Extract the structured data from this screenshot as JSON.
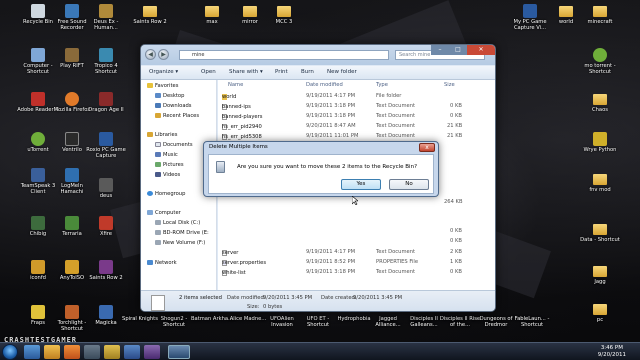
{
  "desktop_icons_left": [
    {
      "label": "Recycle Bin",
      "color": "#cfd8e0"
    },
    {
      "label": "Computer - Shortcut",
      "color": "#7fa7d6"
    },
    {
      "label": "Adobe Reader X",
      "color": "#c0302a"
    },
    {
      "label": "uTorrent",
      "color": "#6fae3a"
    },
    {
      "label": "TeamSpeak 3 Client",
      "color": "#3a5f9a"
    },
    {
      "label": "Chibig",
      "color": "#3d6b3d"
    },
    {
      "label": "iconfd",
      "color": "#d09a2a"
    },
    {
      "label": "Fraps",
      "color": "#e0c23a"
    }
  ],
  "desktop_icons_col2": [
    {
      "label": "Free Sound Recorder",
      "color": "#3a78b8"
    },
    {
      "label": "Play RIFT",
      "color": "#8a6a3a"
    },
    {
      "label": "Mozilla Firefox",
      "color": "#e07a2a"
    },
    {
      "label": "Ventrilo",
      "color": "#2a2a2a"
    },
    {
      "label": "LogMeIn Hamachi",
      "color": "#2f6fb0"
    },
    {
      "label": "Terraria",
      "color": "#4a8a3a"
    },
    {
      "label": "AnyToISO",
      "color": "#d4a02a"
    },
    {
      "label": "Torchlight - Shortcut",
      "color": "#c0602a"
    }
  ],
  "desktop_icons_col3": [
    {
      "label": "Deus Ex - Human...",
      "color": "#b08a3a"
    },
    {
      "label": "Tropico 4 Shortcut",
      "color": "#3a8ab0"
    },
    {
      "label": "Dragon Age II",
      "color": "#8a2a2a"
    },
    {
      "label": "Roxio PC Game Capture",
      "color": "#2a5aa0"
    },
    {
      "label": "deus",
      "color": "#5a5a5a"
    },
    {
      "label": "Xfire",
      "color": "#c03a2a"
    },
    {
      "label": "Saints Row 2",
      "color": "#7a3a8a"
    },
    {
      "label": "Magicka",
      "color": "#3a6ab0"
    }
  ],
  "desktop_icons_top": [
    {
      "label": "Saints Row 2"
    },
    {
      "label": "max"
    },
    {
      "label": "mirror"
    },
    {
      "label": "MCC 3"
    }
  ],
  "desktop_icons_bottom": [
    {
      "label": "Spiral Knights",
      "color": "#3a7ab0"
    },
    {
      "label": "Shogun2 - Shortcut",
      "color": "#8a2a2a"
    },
    {
      "label": "Batman Arkha...",
      "color": "#2a2a2a"
    },
    {
      "label": "Alice Madne...",
      "color": "#6a2a6a"
    },
    {
      "label": "UFOAlien Invasion",
      "color": "#3a5a3a"
    },
    {
      "label": "UFO ET - Shortcut",
      "color": "#2a4a6a"
    },
    {
      "label": "Hydrophobia",
      "color": "#2a6a8a"
    },
    {
      "label": "Jagged Alliance...",
      "color": "#6a5a2a"
    },
    {
      "label": "Disciples II Galleans...",
      "color": "#7a2a2a"
    },
    {
      "label": "Disciples II Rise of the...",
      "color": "#5a2a2a"
    },
    {
      "label": "Dungeons of Dredmor",
      "color": "#8a6a2a"
    },
    {
      "label": "FableLaun... - Shortcut",
      "color": "#3a3a7a"
    }
  ],
  "desktop_icons_right": [
    {
      "label": "My PC Game Capture Vi...",
      "color": "#2a5aa0"
    },
    {
      "label": "world"
    },
    {
      "label": "minecraft"
    },
    {
      "label": "mo torrent - Shortcut",
      "color": "#6fae3a"
    },
    {
      "label": "Chaos"
    },
    {
      "label": "Wrye Python",
      "color": "#d0b02a"
    },
    {
      "label": "fnv mod"
    },
    {
      "label": "Data - Shortcut"
    },
    {
      "label": "Jagg"
    },
    {
      "label": "pc"
    }
  ],
  "explorer": {
    "address": "mine",
    "search_placeholder": "Search mine",
    "toolbar": {
      "organize": "Organize ▾",
      "open": "Open",
      "share_with": "Share with ▾",
      "print": "Print",
      "burn": "Burn",
      "new_folder": "New folder"
    },
    "nav": {
      "favorites": "Favorites",
      "desktop": "Desktop",
      "downloads": "Downloads",
      "recent_places": "Recent Places",
      "libraries": "Libraries",
      "documents": "Documents",
      "music": "Music",
      "pictures": "Pictures",
      "videos": "Videos",
      "homegroup": "Homegroup",
      "computer": "Computer",
      "local_disk": "Local Disk (C:)",
      "bd_rom": "BD-ROM Drive (E:",
      "new_volume": "New Volume (F:)",
      "network": "Network"
    },
    "columns": {
      "name": "Name",
      "date_modified": "Date modified",
      "type": "Type",
      "size": "Size"
    },
    "files": [
      {
        "name": "world",
        "date": "9/19/2011 4:17 PM",
        "type": "File folder",
        "size": "",
        "kind": "folder"
      },
      {
        "name": "banned-ips",
        "date": "9/19/2011 3:18 PM",
        "type": "Text Document",
        "size": "0 KB",
        "kind": "text"
      },
      {
        "name": "banned-players",
        "date": "9/19/2011 3:18 PM",
        "type": "Text Document",
        "size": "0 KB",
        "kind": "text"
      },
      {
        "name": "hs_err_pid2940",
        "date": "9/20/2011 8:47 AM",
        "type": "Text Document",
        "size": "21 KB",
        "kind": "text"
      },
      {
        "name": "hs_err_pid5308",
        "date": "9/19/2011 11:01 PM",
        "type": "Text Document",
        "size": "21 KB",
        "kind": "text"
      },
      {
        "name": "server",
        "date": "9/19/2011 4:17 PM",
        "type": "Text Document",
        "size": "2 KB",
        "kind": "text"
      },
      {
        "name": "server.properties",
        "date": "9/19/2011 8:52 PM",
        "type": "PROPERTIES File",
        "size": "1 KB",
        "kind": "file"
      },
      {
        "name": "white-list",
        "date": "9/19/2011 3:18 PM",
        "type": "Text Document",
        "size": "0 KB",
        "kind": "text"
      }
    ],
    "partial_sizes": [
      "264 KB",
      "0 KB",
      "0 KB"
    ],
    "status": {
      "selected": "2 items selected",
      "date_modified_label": "Date modified:",
      "date_modified_value": "9/20/2011 3:45 PM",
      "date_created_label": "Date created:",
      "date_created_value": "9/20/2011 3:45 PM",
      "size_label": "Size:",
      "size_value": "0 bytes"
    }
  },
  "dialog": {
    "title": "Delete Multiple Items",
    "message": "Are you sure you want to move these 2 items to the Recycle Bin?",
    "yes": "Yes",
    "no": "No",
    "close": "x"
  },
  "taskbar": {
    "time": "3:46 PM",
    "date": "9/20/2011"
  },
  "watermark": "CRASHTESTGAMER"
}
